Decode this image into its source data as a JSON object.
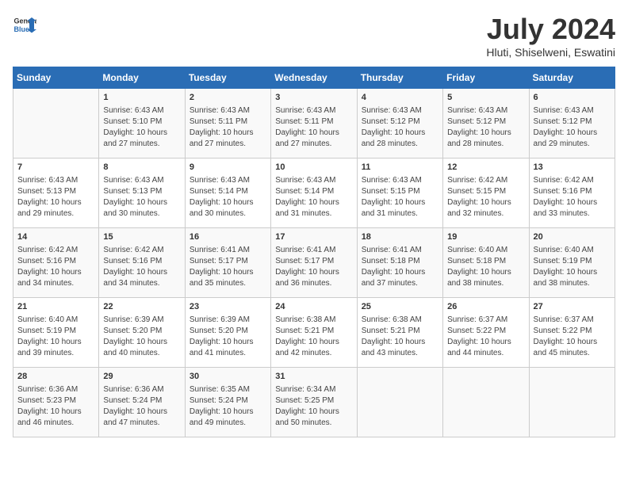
{
  "header": {
    "logo": {
      "general": "General",
      "blue": "Blue"
    },
    "title": "July 2024",
    "location": "Hluti, Shiselweni, Eswatini"
  },
  "days_of_week": [
    "Sunday",
    "Monday",
    "Tuesday",
    "Wednesday",
    "Thursday",
    "Friday",
    "Saturday"
  ],
  "weeks": [
    [
      {
        "day": "",
        "info": ""
      },
      {
        "day": "1",
        "info": "Sunrise: 6:43 AM\nSunset: 5:10 PM\nDaylight: 10 hours\nand 27 minutes."
      },
      {
        "day": "2",
        "info": "Sunrise: 6:43 AM\nSunset: 5:11 PM\nDaylight: 10 hours\nand 27 minutes."
      },
      {
        "day": "3",
        "info": "Sunrise: 6:43 AM\nSunset: 5:11 PM\nDaylight: 10 hours\nand 27 minutes."
      },
      {
        "day": "4",
        "info": "Sunrise: 6:43 AM\nSunset: 5:12 PM\nDaylight: 10 hours\nand 28 minutes."
      },
      {
        "day": "5",
        "info": "Sunrise: 6:43 AM\nSunset: 5:12 PM\nDaylight: 10 hours\nand 28 minutes."
      },
      {
        "day": "6",
        "info": "Sunrise: 6:43 AM\nSunset: 5:12 PM\nDaylight: 10 hours\nand 29 minutes."
      }
    ],
    [
      {
        "day": "7",
        "info": "Sunrise: 6:43 AM\nSunset: 5:13 PM\nDaylight: 10 hours\nand 29 minutes."
      },
      {
        "day": "8",
        "info": "Sunrise: 6:43 AM\nSunset: 5:13 PM\nDaylight: 10 hours\nand 30 minutes."
      },
      {
        "day": "9",
        "info": "Sunrise: 6:43 AM\nSunset: 5:14 PM\nDaylight: 10 hours\nand 30 minutes."
      },
      {
        "day": "10",
        "info": "Sunrise: 6:43 AM\nSunset: 5:14 PM\nDaylight: 10 hours\nand 31 minutes."
      },
      {
        "day": "11",
        "info": "Sunrise: 6:43 AM\nSunset: 5:15 PM\nDaylight: 10 hours\nand 31 minutes."
      },
      {
        "day": "12",
        "info": "Sunrise: 6:42 AM\nSunset: 5:15 PM\nDaylight: 10 hours\nand 32 minutes."
      },
      {
        "day": "13",
        "info": "Sunrise: 6:42 AM\nSunset: 5:16 PM\nDaylight: 10 hours\nand 33 minutes."
      }
    ],
    [
      {
        "day": "14",
        "info": "Sunrise: 6:42 AM\nSunset: 5:16 PM\nDaylight: 10 hours\nand 34 minutes."
      },
      {
        "day": "15",
        "info": "Sunrise: 6:42 AM\nSunset: 5:16 PM\nDaylight: 10 hours\nand 34 minutes."
      },
      {
        "day": "16",
        "info": "Sunrise: 6:41 AM\nSunset: 5:17 PM\nDaylight: 10 hours\nand 35 minutes."
      },
      {
        "day": "17",
        "info": "Sunrise: 6:41 AM\nSunset: 5:17 PM\nDaylight: 10 hours\nand 36 minutes."
      },
      {
        "day": "18",
        "info": "Sunrise: 6:41 AM\nSunset: 5:18 PM\nDaylight: 10 hours\nand 37 minutes."
      },
      {
        "day": "19",
        "info": "Sunrise: 6:40 AM\nSunset: 5:18 PM\nDaylight: 10 hours\nand 38 minutes."
      },
      {
        "day": "20",
        "info": "Sunrise: 6:40 AM\nSunset: 5:19 PM\nDaylight: 10 hours\nand 38 minutes."
      }
    ],
    [
      {
        "day": "21",
        "info": "Sunrise: 6:40 AM\nSunset: 5:19 PM\nDaylight: 10 hours\nand 39 minutes."
      },
      {
        "day": "22",
        "info": "Sunrise: 6:39 AM\nSunset: 5:20 PM\nDaylight: 10 hours\nand 40 minutes."
      },
      {
        "day": "23",
        "info": "Sunrise: 6:39 AM\nSunset: 5:20 PM\nDaylight: 10 hours\nand 41 minutes."
      },
      {
        "day": "24",
        "info": "Sunrise: 6:38 AM\nSunset: 5:21 PM\nDaylight: 10 hours\nand 42 minutes."
      },
      {
        "day": "25",
        "info": "Sunrise: 6:38 AM\nSunset: 5:21 PM\nDaylight: 10 hours\nand 43 minutes."
      },
      {
        "day": "26",
        "info": "Sunrise: 6:37 AM\nSunset: 5:22 PM\nDaylight: 10 hours\nand 44 minutes."
      },
      {
        "day": "27",
        "info": "Sunrise: 6:37 AM\nSunset: 5:22 PM\nDaylight: 10 hours\nand 45 minutes."
      }
    ],
    [
      {
        "day": "28",
        "info": "Sunrise: 6:36 AM\nSunset: 5:23 PM\nDaylight: 10 hours\nand 46 minutes."
      },
      {
        "day": "29",
        "info": "Sunrise: 6:36 AM\nSunset: 5:24 PM\nDaylight: 10 hours\nand 47 minutes."
      },
      {
        "day": "30",
        "info": "Sunrise: 6:35 AM\nSunset: 5:24 PM\nDaylight: 10 hours\nand 49 minutes."
      },
      {
        "day": "31",
        "info": "Sunrise: 6:34 AM\nSunset: 5:25 PM\nDaylight: 10 hours\nand 50 minutes."
      },
      {
        "day": "",
        "info": ""
      },
      {
        "day": "",
        "info": ""
      },
      {
        "day": "",
        "info": ""
      }
    ]
  ]
}
